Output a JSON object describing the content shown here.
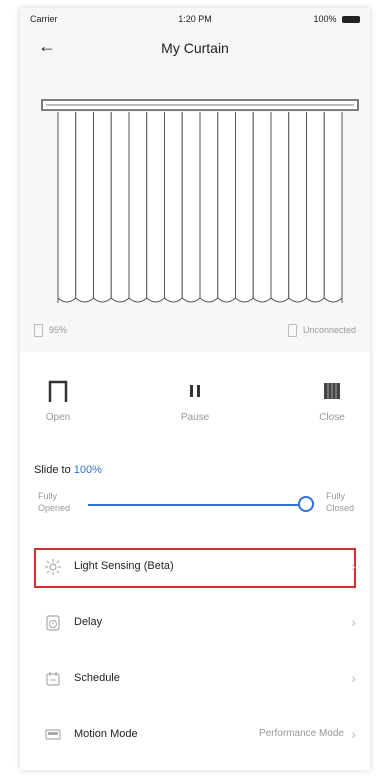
{
  "status_bar": {
    "carrier": "Carrier",
    "time": "1:20 PM",
    "battery": "100%"
  },
  "header": {
    "title": "My Curtain"
  },
  "curtain": {
    "battery": "95%",
    "connection": "Unconnected"
  },
  "controls": {
    "open_label": "Open",
    "pause_label": "Pause",
    "close_label": "Close"
  },
  "slider": {
    "prefix": "Slide to",
    "value": "100%",
    "left_label_1": "Fully",
    "left_label_2": "Opened",
    "right_label_1": "Fully",
    "right_label_2": "Closed",
    "fraction": 1.0
  },
  "menu": {
    "items": [
      {
        "label": "Light Sensing (Beta)",
        "icon": "sun-icon",
        "value": ""
      },
      {
        "label": "Delay",
        "icon": "clock-icon",
        "value": ""
      },
      {
        "label": "Schedule",
        "icon": "calendar-icon",
        "value": ""
      },
      {
        "label": "Motion Mode",
        "icon": "motion-icon",
        "value": "Performance Mode"
      }
    ]
  },
  "colors": {
    "accent": "#2e72d2",
    "highlight": "#d32f2f"
  }
}
